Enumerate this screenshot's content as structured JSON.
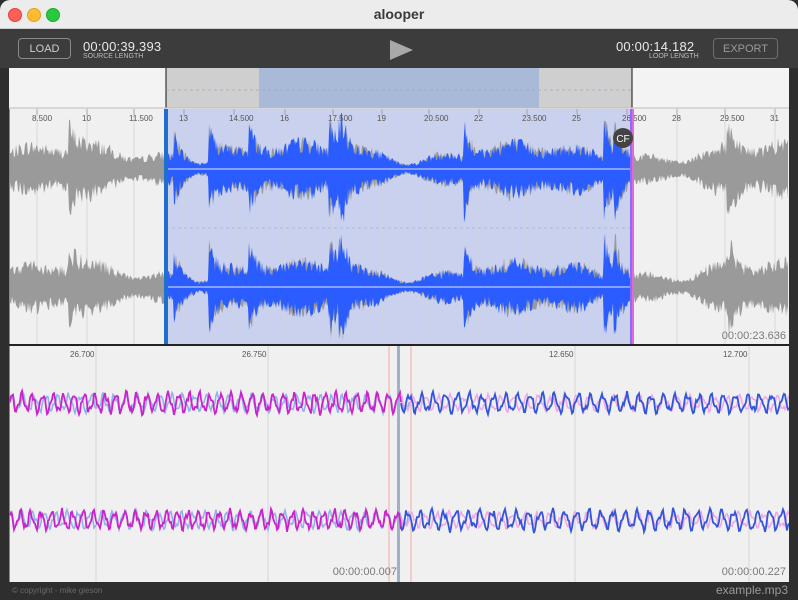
{
  "window": {
    "title": "alooper"
  },
  "toolbar": {
    "load_label": "LOAD",
    "export_label": "EXPORT",
    "source_time": "00:00:39.393",
    "source_caption": "SOURCE LENGTH",
    "loop_time": "00:00:14.182",
    "loop_caption": "LOOP LENGTH"
  },
  "overview": {
    "ticks": [
      "8.500",
      "10",
      "11.500",
      "13",
      "14.500",
      "16",
      "17.500",
      "19",
      "20.500",
      "22",
      "23.500",
      "25",
      "26.500",
      "28",
      "29.500",
      "31"
    ],
    "crossfade_badge": "CF",
    "time_readout": "00:00:23.636"
  },
  "detail": {
    "ticks": [
      "26.700",
      "26.750",
      "12.650",
      "12.700"
    ],
    "time_left": "00:00:00.007",
    "time_right": "00:00:00.227"
  },
  "status": {
    "copyright": "© copyright - mike gieson",
    "filename": "example.mp3"
  },
  "colors": {
    "selection": "#c9d1ee",
    "waveform_selected": "#2a5cff",
    "waveform_unselected": "#9a9a9a",
    "loop_end_wave": "#cc22cc",
    "loop_start_wave": "#3355dd"
  }
}
